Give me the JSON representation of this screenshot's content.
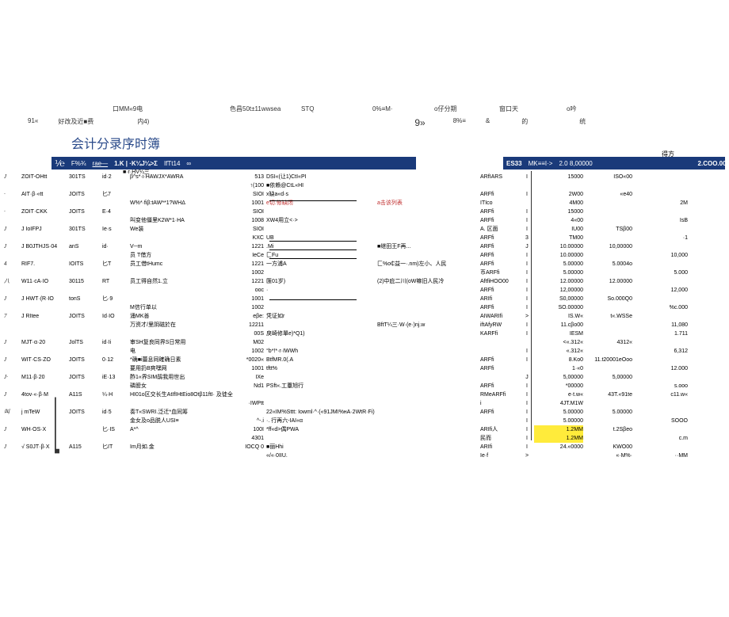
{
  "header": {
    "mm9": "口MM«9电",
    "sebi": "色昌50t±11wwsea",
    "stq": "STQ",
    "pct": "0%≡M·",
    "fenqi": "o仔分期",
    "nine": "9»",
    "chuang": "窗口天",
    "de": "的",
    "yin": "o吟",
    "tong": "统",
    "left91": "91«",
    "haogai": "好改及近■费",
    "nei4": "内4)",
    "bpct": "8%≡",
    "amp": "&"
  },
  "title": "会计分录序时簿",
  "blueband_left": {
    "frac": "⅟℮",
    "fpct": "F%¾",
    "rae": "rae—",
    "k1": "1.K | ·K¼J¼>Σ",
    "k2": "■·r·HV¼三",
    "iftt": "IfTt14",
    "dot": "∞"
  },
  "blueband_right": {
    "es33": "ES33",
    "mk": "MK≡≡I·>",
    "v1": "2.0 8,00000",
    "defang": "得方",
    "v2": "2.COO.000"
  },
  "rows": [
    {
      "mark": "J",
      "c1": "ZOIT-OHtt",
      "c2": "301TS",
      "c3": "id·2",
      "desc": "β^s*·i·HAWJX*AWRA",
      "n1": "513",
      "mid": "DSI«(让1)CtI«PI",
      "note": "",
      "acct": "ARfIARS",
      "flag": "I",
      "v1": "15000",
      "v2": "ISO«00",
      "extra": ""
    },
    {
      "mark": "",
      "c1": "",
      "c2": "",
      "c3": "",
      "desc": "",
      "n1": "↑(100",
      "mid": "■依赖@CtL«HI",
      "note": "",
      "acct": "",
      "flag": "",
      "v1": "",
      "v2": "",
      "extra": ""
    },
    {
      "mark": "·",
      "c1": "AIT·β·«tt",
      "c2": "JOITS",
      "c3": "匕7",
      "desc": "",
      "n1": "SIOI",
      "mid": "x缺a«d·s",
      "note": "",
      "acct": "ARFfi",
      "flag": "I",
      "v1": "2W00",
      "v2": "«e40",
      "extra": ""
    },
    {
      "mark": "",
      "c1": "",
      "c2": "",
      "c3": "",
      "desc": "W%*·fiβ:tAW**1?WHΔ",
      "n1": "1001",
      "mid": "e切.修缺闭",
      "note": "a击该列表",
      "acct": "ITIco",
      "flag": "",
      "v1": "4M00",
      "v2": "",
      "extra": "2M"
    },
    {
      "mark": "·",
      "c1": "ZOIT·CKK",
      "c2": "JOITS",
      "c3": "E·4",
      "desc": "",
      "n1": "SIOI",
      "mid": "",
      "note": "",
      "acct": "ARFfi",
      "flag": "I",
      "v1": "15000",
      "v2": "",
      "extra": ""
    },
    {
      "mark": "",
      "c1": "",
      "c2": "",
      "c3": "",
      "desc": "叫变他僵里K2W*1·HA",
      "n1": "1008",
      "mid": "XW4用立<·>",
      "note": "",
      "acct": "ARFfi",
      "flag": "I",
      "v1": "4«00",
      "v2": "",
      "extra": "IsΒ"
    },
    {
      "mark": "J",
      "c1": "J   IoIFPJ",
      "c2": "301TS",
      "c3": "Ie·s",
      "desc": "We装",
      "n1": "SIOI",
      "mid": "",
      "note": "",
      "acct": "A. 区面",
      "flag": "I",
      "v1": "IU00",
      "v2": "TSβ00",
      "extra": ""
    },
    {
      "mark": "",
      "c1": "",
      "c2": "",
      "c3": "",
      "desc": "",
      "n1": "KXC",
      "mid": "UB",
      "note": "",
      "acct": "ARFfi",
      "flag": "3",
      "v1": "TM00",
      "v2": "",
      "extra": "·1"
    },
    {
      "mark": "J",
      "c1": "J   B0JTHJS·04",
      "c2": "anS",
      "c3": "id·",
      "desc": "V─m",
      "n1": "1221",
      "mid": "   .Mi",
      "note": "■继田王F再...",
      "acct": "ARFfi",
      "flag": "J",
      "v1": "10.00000",
      "v2": "10,00000",
      "extra": ""
    },
    {
      "mark": "",
      "c1": "",
      "c2": "",
      "c3": "",
      "desc": "员 T借方",
      "n1": "IeCe",
      "mid": "匚Fu",
      "note": "",
      "acct": "ARFfi",
      "flag": "I",
      "v1": "10.00000",
      "v2": "",
      "extra": "10,000"
    },
    {
      "mark": "4",
      "c1": "    RIF7.",
      "c2": "IOITS",
      "c3": "匕T",
      "desc": "员工借tHumc",
      "n1": "1221",
      "mid": "    一方浦A",
      "note": "匚%o₵益一·.nm)左小、人民",
      "acct": "ARFfi",
      "flag": "I",
      "v1": "5.00000",
      "v2": "5.0004o",
      "extra": ""
    },
    {
      "mark": "",
      "c1": "",
      "c2": "",
      "c3": "",
      "desc": "",
      "n1": "1002",
      "mid": "",
      "note": "",
      "acct": "币ARFfi",
      "flag": "I",
      "v1": "5.00000",
      "v2": "",
      "extra": "5.000"
    },
    {
      "mark": "八",
      "c1": "    W11·cA·IO",
      "c2": "30115",
      "c3": "RT",
      "desc": "员工得自然1.立",
      "n1": "1221",
      "mid": "    匯01岁)",
      "note": "(2)中庇二川(oW嘛旧人民冷",
      "acct": "AftfiHOO00",
      "flag": "I",
      "v1": "12.00000",
      "v2": "12.00000",
      "extra": ""
    },
    {
      "mark": "",
      "c1": "",
      "c2": "",
      "c3": "",
      "desc": "",
      "n1": "ooc",
      "mid": "·",
      "note": "",
      "acct": "ARFfi",
      "flag": "I",
      "v1": "12,00000",
      "v2": "",
      "extra": "12,000"
    },
    {
      "mark": "J",
      "c1": "J   HWT·(R·IO",
      "c2": "tonS",
      "c3": "匕·9",
      "desc": "",
      "n1": "1001",
      "mid": "",
      "note": "",
      "acct": "ARIfi",
      "flag": "I",
      "v1": "S0,00000",
      "v2": "So.000Q0",
      "extra": ""
    },
    {
      "mark": "",
      "c1": "",
      "c2": "",
      "c3": "",
      "desc": "M信行单以",
      "n1": "1002",
      "mid": "",
      "note": "",
      "acct": "ARFfi",
      "flag": "I",
      "v1": "SO.00000",
      "v2": "",
      "extra": "%c.000"
    },
    {
      "mark": "7",
      "c1": "J   RItee",
      "c2": "JOITS",
      "c3": "Id·IO",
      "desc": "涌MK善",
      "n1": "eβe:",
      "mid": "    凭证如r",
      "note": "",
      "acct": "AIWARIfi",
      "flag": ">",
      "v1": "IS.W«",
      "v2": "t«.WSSe",
      "extra": ""
    },
    {
      "mark": "",
      "c1": "",
      "c2": "",
      "c3": "",
      "desc": "万资才/里阴磁於在",
      "n1": "12211",
      "mid": "",
      "note": "BftT¼三·W·(e·)nj.w",
      "acct": "iftAfyRW",
      "flag": "I",
      "v1": "11.cβo00",
      "v2": "",
      "extra": "11,080"
    },
    {
      "mark": "",
      "c1": "",
      "c2": "",
      "c3": "",
      "desc": "",
      "n1": "00S",
      "mid": "    戾崎修單e)*Q1)",
      "note": "",
      "acct": "KARFfi",
      "flag": "I",
      "v1": "IESM",
      "v2": "",
      "extra": "1.711"
    },
    {
      "mark": "J",
      "c1": "    MJT·α·20",
      "c2": "JolTS",
      "c3": "id·Ii",
      "desc": "审SH复良同界S日常用",
      "n1": "M02",
      "mid": "",
      "note": "",
      "acct": "",
      "flag": "",
      "v1": "<«.312«",
      "v2": "4312«",
      "extra": ""
    },
    {
      "mark": "",
      "c1": "",
      "c2": "",
      "c3": "",
      "desc": "电",
      "n1": "1002",
      "mid": "    °b*!*·r·IWWh",
      "note": "",
      "acct": "",
      "flag": "I",
      "v1": "«.312«",
      "v2": "",
      "extra": "6,312"
    },
    {
      "mark": "J",
      "c1": "    WIT·CS·ZO",
      "c2": "JOITS",
      "c3": "0·12",
      "desc": "*确■i蕾息同確确日素",
      "n1": "*0020«",
      "mid": "    BtfMR.0(.A",
      "note": "",
      "acct": "ARFfi",
      "flag": "I",
      "v1": "8.Ko0",
      "v2": "11.t20001eOoo",
      "extra": ""
    },
    {
      "mark": "",
      "c1": "",
      "c2": "",
      "c3": "",
      "desc": "要用扔B爽嘿网",
      "n1": "1001",
      "mid": "    tftt%",
      "note": "",
      "acct": "ARFfi",
      "flag": "",
      "v1": "1·«0",
      "v2": "",
      "extra": "12.000"
    },
    {
      "mark": "J·",
      "c1": "    M11·β·20",
      "c2": "JOITS",
      "c3": "iE·13",
      "desc": "酢1«界SIM鹃我用世出",
      "n1": "IXe",
      "mid": "",
      "note": "",
      "acct": "",
      "flag": "J",
      "v1": "5,00000",
      "v2": "5,00000",
      "extra": ""
    },
    {
      "mark": "",
      "c1": "",
      "c2": "",
      "c3": "",
      "desc": "磷膀女",
      "n1": "Nd1",
      "mid": "    PSft«.工薹旭行",
      "note": "",
      "acct": "ARFfi",
      "flag": "I",
      "v1": "*00000",
      "v2": "",
      "extra": "s.ooo"
    },
    {
      "mark": "J",
      "c1": "    4tov·«·β·M",
      "c2": "A11S",
      "c3": "¼·H",
      "desc": "HI01o区交长生AtIfIHtEio8Otβ11ftI·    及徒全",
      "n1": "",
      "mid": "",
      "note": "",
      "acct": "RMeARFfi",
      "flag": "I",
      "v1": "e·t.w«",
      "v2": "43T.«91te",
      "extra": "c11.w«"
    },
    {
      "mark": "",
      "c1": "",
      "c2": "",
      "c3": "",
      "desc": "",
      "n1": "·IWPtt",
      "mid": "",
      "note": "",
      "acct": "i",
      "flag": "I",
      "v1": "4JT.M1W",
      "v2": "",
      "extra": ""
    },
    {
      "mark": "叫",
      "c1": "j    mTeW",
      "c2": "JOITS",
      "c3": "id·5",
      "desc": "奏T«SWRI.泛迁*血同筹",
      "n1": "",
      "mid": "22«IM%Sttt: Iowml·^·(«91JMI%нA·2WtR·Fi)",
      "note": "",
      "acct": "ARFfi",
      "flag": "I",
      "v1": "5.00000",
      "v2": "5.00000",
      "extra": ""
    },
    {
      "mark": "",
      "c1": "",
      "c2": "",
      "c3": "",
      "desc": "金女及o品脱人USI≡",
      "n1": "^-.i",
      "mid": "    ·. 行再六-IAI«α",
      "note": "",
      "acct": "",
      "flag": "I",
      "v1": "5.00000",
      "v2": "",
      "extra": "SOOO"
    },
    {
      "mark": "J",
      "c1": "    WH·OS·X",
      "c2": "",
      "c3": "匕·IS",
      "desc": "A*^",
      "n1": "100I",
      "mid": "    *ff«d>偶PWA",
      "note": "",
      "acct": "ARIfi人",
      "flag": "I",
      "v1": "1.2MM",
      "v2": "t.2Sβeo",
      "extra": ""
    },
    {
      "mark": "",
      "c1": "",
      "c2": "",
      "c3": "",
      "desc": "",
      "n1": "4301",
      "mid": "",
      "note": "",
      "acct": "民而",
      "flag": "I",
      "v1": "1.2MM",
      "v2": "",
      "extra": "c.m"
    },
    {
      "mark": "J",
      "c1": "√   S0JT·β·X",
      "c2": "A115",
      "c3": "匕IT",
      "desc": "Im月如.金",
      "n1": "IOCQ  0",
      "mid": "            ■丽Hhi",
      "note": "",
      "acct": "ARIfi",
      "flag": "I",
      "v1": "24.«0000",
      "v2": "KWO00",
      "extra": ""
    },
    {
      "mark": "",
      "c1": "",
      "c2": "",
      "c3": "",
      "desc": "",
      "n1": "",
      "mid": "    «/«·0IIU.",
      "note": "",
      "acct": "Ie·f",
      "flag": ">",
      "v1": "",
      "v2": "«·M%·",
      "extra": "··MM"
    }
  ]
}
